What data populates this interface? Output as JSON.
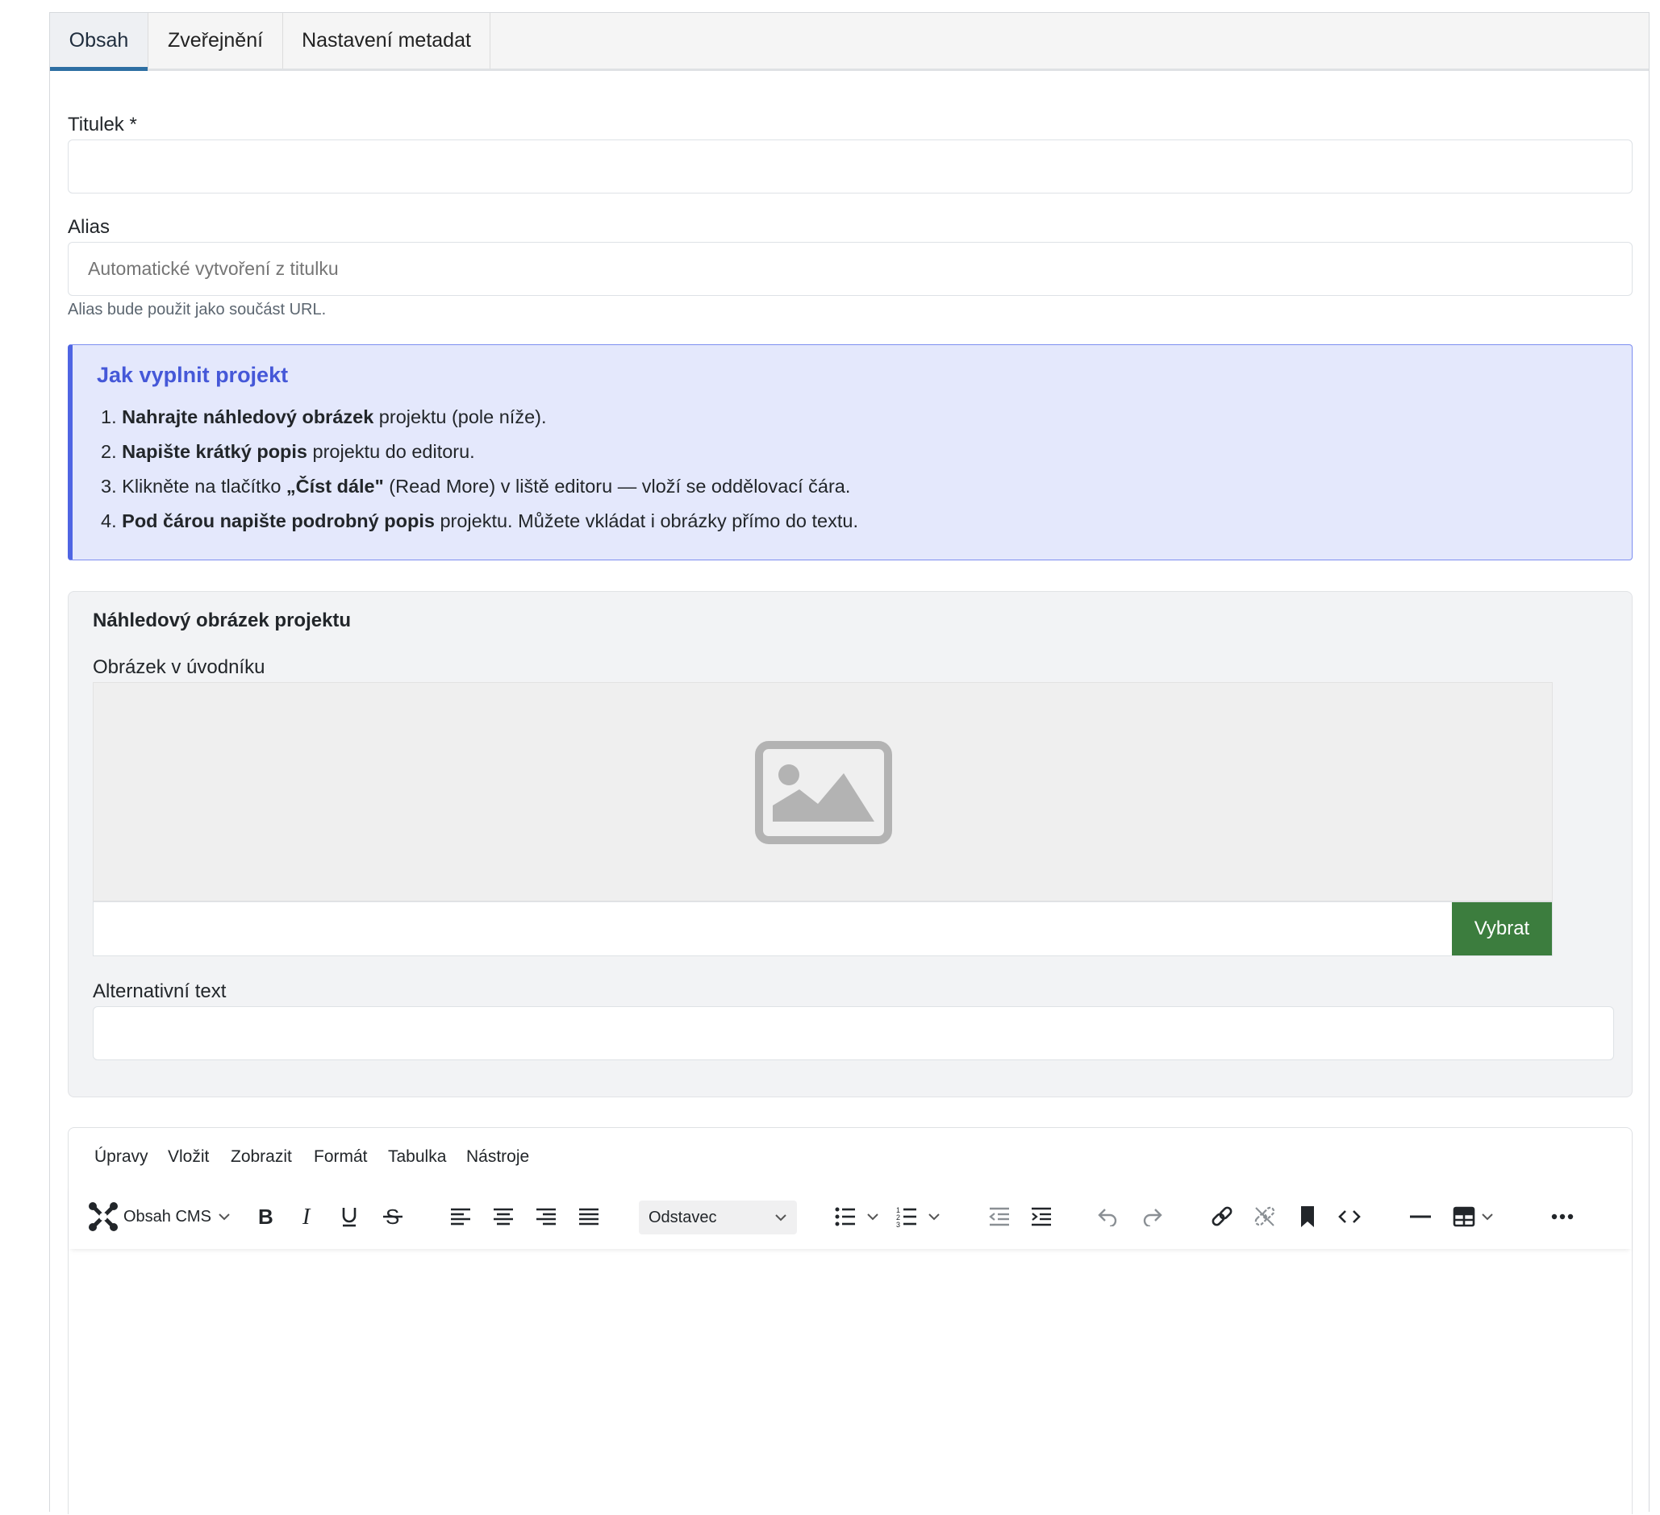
{
  "tabs": [
    {
      "label": "Obsah",
      "active": true
    },
    {
      "label": "Zveřejnění",
      "active": false
    },
    {
      "label": "Nastavení metadat",
      "active": false
    }
  ],
  "form": {
    "title_label": "Titulek *",
    "title_value": "",
    "alias_label": "Alias",
    "alias_placeholder": "Automatické vytvoření z titulku",
    "alias_hint": "Alias bude použit jako součást URL."
  },
  "info": {
    "title": "Jak vyplnit projekt",
    "items": [
      {
        "num": "1.",
        "bold": "Nahrajte náhledový obrázek",
        "rest": " projektu (pole níže)."
      },
      {
        "num": "2.",
        "bold": "Napište krátký popis",
        "rest": " projektu do editoru."
      },
      {
        "num": "3.",
        "pre": " Klikněte na tlačítko ",
        "bold": "„Číst dále\"",
        "rest": " (Read More) v liště editoru — vloží se oddělovací čára."
      },
      {
        "num": "4.",
        "bold": "Pod čárou napište podrobný popis",
        "rest": " projektu. Můžete vkládat i obrázky přímo do textu."
      }
    ],
    "accent_color": "#4f65e3"
  },
  "image_card": {
    "title": "Náhledový obrázek projektu",
    "image_label": "Obrázek v úvodníku",
    "image_value": "",
    "select_button": "Vybrat",
    "alt_label": "Alternativní text",
    "alt_value": "",
    "button_color": "#3c7d3e"
  },
  "editor": {
    "menu": [
      "Úpravy",
      "Vložit",
      "Zobrazit",
      "Formát",
      "Tabulka",
      "Nástroje"
    ],
    "cms_button": "Obsah CMS",
    "block_format": "Odstavec",
    "toolbar_icons": [
      "joomla-icon",
      "bold-icon",
      "italic-icon",
      "underline-icon",
      "strikethrough-icon",
      "align-left-icon",
      "align-center-icon",
      "align-right-icon",
      "align-justify-icon",
      "bullet-list-icon",
      "numbered-list-icon",
      "outdent-icon",
      "indent-icon",
      "undo-icon",
      "redo-icon",
      "link-icon",
      "unlink-icon",
      "bookmark-icon",
      "code-icon",
      "horizontal-rule-icon",
      "table-icon",
      "more-icon"
    ]
  }
}
